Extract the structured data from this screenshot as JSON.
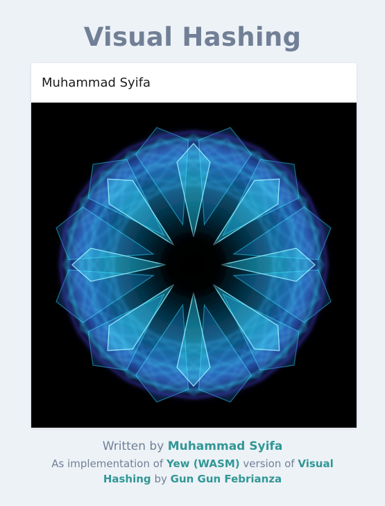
{
  "header": {
    "title": "Visual Hashing"
  },
  "input": {
    "value": "Muhammad Syifa"
  },
  "canvas": {
    "background": "#000000",
    "colors": [
      "#2bd9ff",
      "#2f86ff",
      "#4a3fe0",
      "#8fe9ff"
    ]
  },
  "footer": {
    "written_by": "Written by",
    "author": "Muhammad Syifa",
    "as_implementation_of": "As implementation of",
    "yew_link": "Yew (WASM)",
    "version_of": "version of",
    "visual_hashing_link": "Visual Hashing",
    "by": "by",
    "original_author": "Gun Gun Febrianza"
  },
  "colors": {
    "background": "#edf2f7",
    "title": "#718096",
    "link": "#319795"
  }
}
